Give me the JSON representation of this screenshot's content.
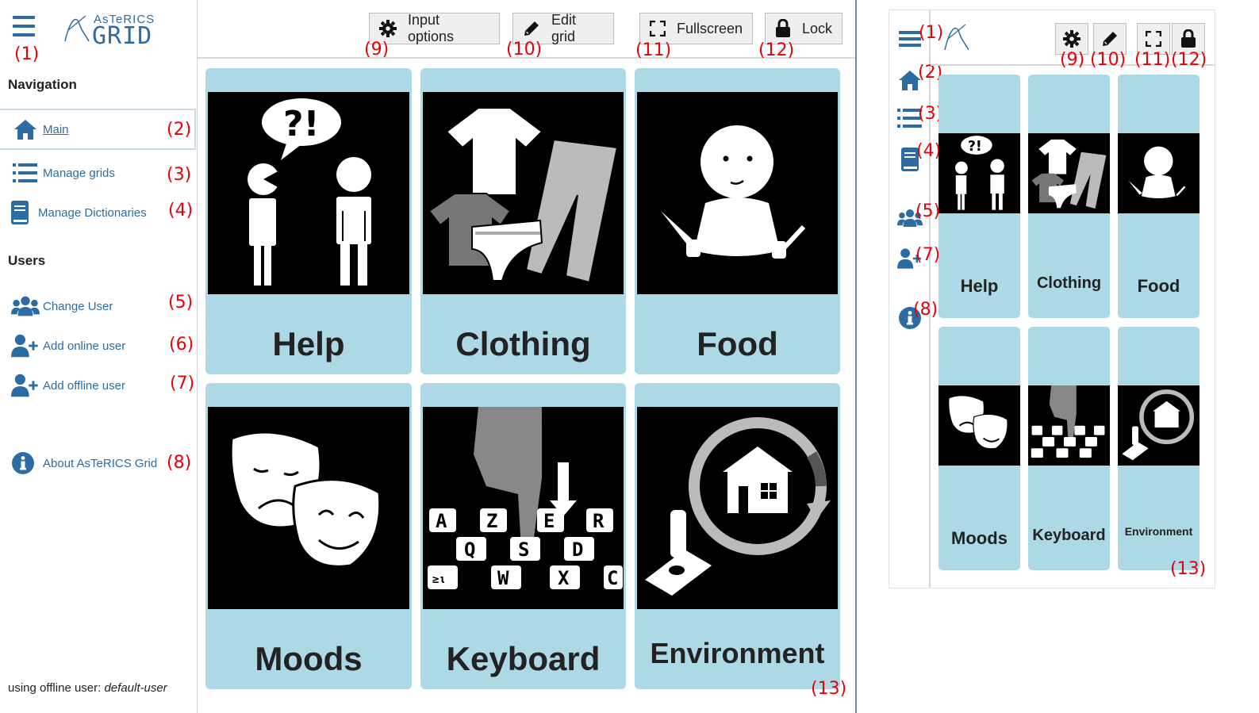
{
  "app": {
    "logo_top": "AsTeRICS",
    "logo_bottom": "GRID"
  },
  "sidebar": {
    "nav_heading": "Navigation",
    "nav_items": [
      {
        "label": "Main",
        "icon": "home-icon",
        "marker": "(2)"
      },
      {
        "label": "Manage grids",
        "icon": "list-icon",
        "marker": "(3)"
      },
      {
        "label": "Manage Dictionaries",
        "icon": "book-icon",
        "marker": "(4)"
      }
    ],
    "users_heading": "Users",
    "user_items": [
      {
        "label": "Change User",
        "icon": "users-icon",
        "marker": "(5)"
      },
      {
        "label": "Add online user",
        "icon": "user-plus-icon",
        "marker": "(6)"
      },
      {
        "label": "Add offline user",
        "icon": "user-plus-icon",
        "marker": "(7)"
      }
    ],
    "about": {
      "label": "About AsTeRICS Grid",
      "icon": "info-icon",
      "marker": "(8)"
    },
    "footer_prefix": "using offline user: ",
    "footer_user": "default-user",
    "menu_marker": "(1)"
  },
  "toolbar": {
    "input_options": "Input options",
    "edit_grid": "Edit grid",
    "fullscreen": "Fullscreen",
    "lock": "Lock",
    "markers": [
      "(9)",
      "(10)",
      "(11)",
      "(12)"
    ]
  },
  "grid": {
    "tiles": [
      "Help",
      "Clothing",
      "Food",
      "Moods",
      "Keyboard",
      "Environment"
    ],
    "marker": "(13)"
  },
  "mini": {
    "side_markers": [
      "(1)",
      "(2)",
      "(3)",
      "(4)",
      "(5)",
      "(7)",
      "(8)"
    ],
    "toolbar_markers": [
      "(9)",
      "(10)",
      "(11)",
      "(12)"
    ],
    "tiles": [
      "Help",
      "Clothing",
      "Food",
      "Moods",
      "Keyboard",
      "Environment"
    ],
    "grid_marker": "(13)"
  },
  "colors": {
    "accent": "#2d6ca2",
    "tile_bg": "#add8e6",
    "marker": "#e8000b"
  }
}
